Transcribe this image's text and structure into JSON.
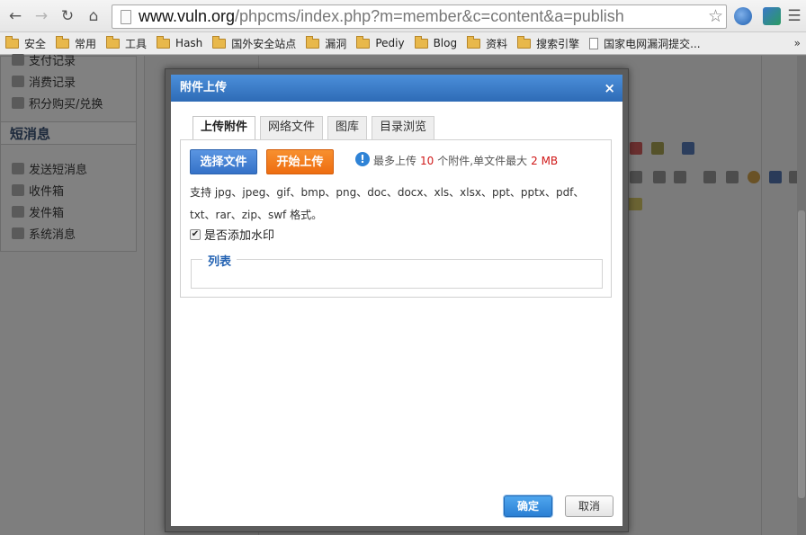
{
  "browser": {
    "url_host": "www.vuln.org",
    "url_path": "/phpcms/index.php?m=member&c=content&a=publish",
    "bookmarks": [
      {
        "label": "安全",
        "type": "folder"
      },
      {
        "label": "常用",
        "type": "folder"
      },
      {
        "label": "工具",
        "type": "folder"
      },
      {
        "label": "Hash",
        "type": "folder"
      },
      {
        "label": "国外安全站点",
        "type": "folder"
      },
      {
        "label": "漏洞",
        "type": "folder"
      },
      {
        "label": "Pediy",
        "type": "folder"
      },
      {
        "label": "Blog",
        "type": "folder"
      },
      {
        "label": "资料",
        "type": "folder"
      },
      {
        "label": "搜索引擎",
        "type": "folder"
      },
      {
        "label": "国家电网漏洞提交...",
        "type": "page"
      }
    ],
    "bookmarks_overflow": "»"
  },
  "sidebar": {
    "items_top": [
      "支付记录",
      "消费记录",
      "积分购买/兑换"
    ],
    "section_title": "短消息",
    "items_bottom": [
      "发送短消息",
      "收件箱",
      "发件箱",
      "系统消息"
    ]
  },
  "dialog": {
    "title": "附件上传",
    "close": "×",
    "tabs": [
      "上传附件",
      "网络文件",
      "图库",
      "目录浏览"
    ],
    "select_button": "选择文件",
    "start_button": "开始上传",
    "info_icon": "!",
    "limit_prefix": "最多上传",
    "max_files": "10",
    "limit_middle": "个附件,单文件最大",
    "max_size": "2 MB",
    "formats_text": "支持 jpg、jpeg、gif、bmp、png、doc、docx、xls、xlsx、ppt、pptx、pdf、txt、rar、zip、swf 格式。",
    "watermark_label": "是否添加水印",
    "watermark_checked": true,
    "list_legend": "列表",
    "ok_button": "确定",
    "cancel_button": "取消"
  },
  "colors": {
    "title_bar": "#3a7cc8",
    "select_button": "#3f7fd2",
    "start_button": "#f27e20",
    "limit_highlight": "#d01818",
    "legend_text": "#2463b3"
  }
}
